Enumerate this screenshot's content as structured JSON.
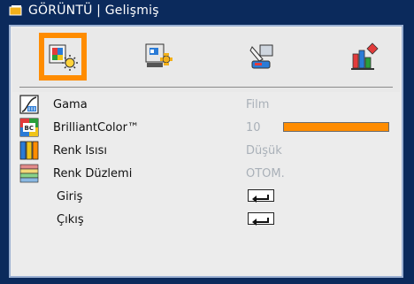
{
  "window": {
    "title": "GÖRÜNTÜ | Gelişmiş"
  },
  "tabs": [
    {
      "icon": "image-settings-icon",
      "selected": true
    },
    {
      "icon": "display-settings-icon",
      "selected": false
    },
    {
      "icon": "setup-icon",
      "selected": false
    },
    {
      "icon": "options-icon",
      "selected": false
    }
  ],
  "menu": {
    "items": [
      {
        "label": "Gama",
        "value": "Film",
        "icon": "gamma-icon"
      },
      {
        "label": "BrilliantColor™",
        "value": "10",
        "icon": "brilliantcolor-icon",
        "level_percent": 100
      },
      {
        "label": "Renk Isısı",
        "value": "Düşük",
        "icon": "color-temperature-icon"
      },
      {
        "label": "Renk Düzlemi",
        "value": "OTOM.",
        "icon": "color-space-icon"
      },
      {
        "label": "Giriş",
        "icon": "enter-icon"
      },
      {
        "label": "Çıkış",
        "icon": "enter-icon"
      }
    ]
  },
  "colors": {
    "accent": "#ff8c00",
    "background": "#0b2a5c",
    "panel": "#ececec",
    "value_text": "#a9b0b8"
  }
}
